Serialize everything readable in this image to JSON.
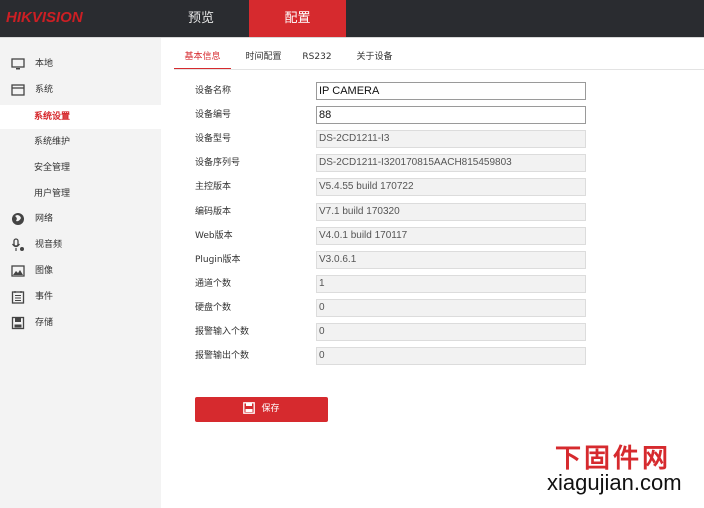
{
  "brand": {
    "logo": "HIKVISION",
    "logo_color": "#cc1f24"
  },
  "top_nav": {
    "preview": "预览",
    "config": "配置",
    "active": "config",
    "accent": "#d62a2e"
  },
  "sidebar": {
    "items": [
      {
        "label": "本地",
        "icon": "monitor-icon"
      },
      {
        "label": "系统",
        "icon": "system-icon"
      },
      {
        "label": "系统设置",
        "sub": true,
        "active": true
      },
      {
        "label": "系统维护",
        "sub": true
      },
      {
        "label": "安全管理",
        "sub": true
      },
      {
        "label": "用户管理",
        "sub": true
      },
      {
        "label": "网络",
        "icon": "globe-icon"
      },
      {
        "label": "视音频",
        "icon": "mic-icon"
      },
      {
        "label": "图像",
        "icon": "image-icon"
      },
      {
        "label": "事件",
        "icon": "calendar-icon"
      },
      {
        "label": "存储",
        "icon": "disk-icon"
      }
    ]
  },
  "subtabs": [
    {
      "label": "基本信息",
      "active": true
    },
    {
      "label": "时间配置"
    },
    {
      "label": "RS232"
    },
    {
      "label": "关于设备"
    }
  ],
  "form": {
    "fields": [
      {
        "label": "设备名称",
        "value": "IP CAMERA",
        "editable": true
      },
      {
        "label": "设备编号",
        "value": "88",
        "editable": true
      },
      {
        "label": "设备型号",
        "value": "DS-2CD1211-I3"
      },
      {
        "label": "设备序列号",
        "value": "DS-2CD1211-I320170815AACH815459803"
      },
      {
        "label": "主控版本",
        "value": "V5.4.55 build 170722"
      },
      {
        "label": "编码版本",
        "value": "V7.1 build 170320"
      },
      {
        "label": "Web版本",
        "value": "V4.0.1 build 170117"
      },
      {
        "label": "Plugin版本",
        "value": "V3.0.6.1"
      },
      {
        "label": "通道个数",
        "value": "1"
      },
      {
        "label": "硬盘个数",
        "value": "0"
      },
      {
        "label": "报警输入个数",
        "value": "0"
      },
      {
        "label": "报警输出个数",
        "value": "0"
      }
    ],
    "save_label": "保存"
  },
  "watermark": {
    "cn": "下固件网",
    "en": "xiagujian.com"
  }
}
